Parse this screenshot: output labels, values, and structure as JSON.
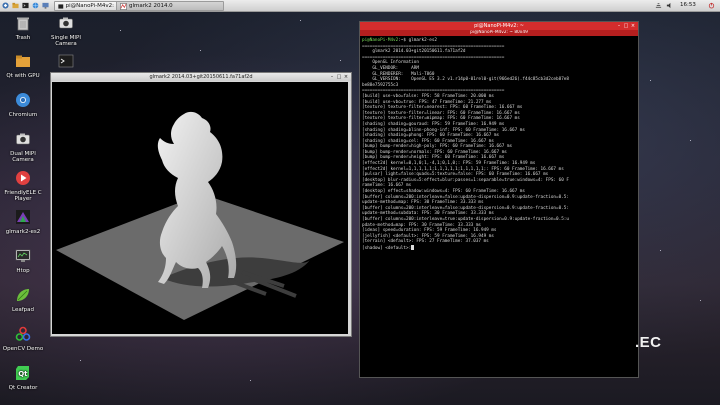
{
  "taskbar": {
    "tasks": [
      {
        "label": "pi@NanoPi-M4v2:"
      },
      {
        "label": "glmark2 2014.0"
      }
    ],
    "clock": "16:53"
  },
  "desktop": {
    "icons": [
      {
        "label": "Trash",
        "icon": "trash-icon"
      },
      {
        "label": "Single MIPI Camera",
        "icon": "camera-icon"
      },
      {
        "label": "Qt with GPU",
        "icon": "folder-icon"
      },
      {
        "label": "",
        "icon": "terminal-icon"
      },
      {
        "label": "Chromium",
        "icon": "chromium-icon"
      },
      {
        "label": "Dual MIPI Camera",
        "icon": "camera-icon"
      },
      {
        "label": "FriendlyELE C Player",
        "icon": "player-icon"
      },
      {
        "label": "glmark2-es2",
        "icon": "glmark-icon"
      },
      {
        "label": "Htop",
        "icon": "monitor-icon"
      },
      {
        "label": "Leafpad",
        "icon": "leafpad-icon"
      },
      {
        "label": "OpenCV Demo",
        "icon": "opencv-icon"
      },
      {
        "label": "Qt Creator",
        "icon": "qt-icon"
      }
    ]
  },
  "glmark_window": {
    "title": "glmark2 2014.03+git20150611.fa71af2d"
  },
  "terminal": {
    "title": "pi@NanoPi-M4v2: ~",
    "subtitle": "pi@NanoPi-M4v2: ~ 80x49",
    "prompt_user": "pi@NanoPi-M4v2",
    "prompt_cmd": ":~$ glmark2-es2",
    "lines": [
      "=======================================================",
      "    glmark2 2014.03+git20150611.fa71af2d",
      "=======================================================",
      "    OpenGL Information",
      "    GL_VENDOR:     ARM",
      "    GL_RENDERER:   Mali-T860",
      "    GL_VERSION:    OpenGL ES 3.2 v1.r14p0-01rel0-git(966ed26).f44c85cb3d2ceb87e8",
      "be88e7592755c3",
      "=======================================================",
      "[build] use-vbo=false: FPS: 58 FrameTime: 20.000 ms",
      "[build] use-vbo=true: FPS: 47 FrameTime: 21.277 ms",
      "[texture] texture-filter=nearest: FPS: 60 FrameTime: 16.667 ms",
      "[texture] texture-filter=linear: FPS: 60 FrameTime: 16.667 ms",
      "[texture] texture-filter=mipmap: FPS: 60 FrameTime: 16.667 ms",
      "[shading] shading=gouraud: FPS: 59 FrameTime: 16.949 ms",
      "[shading] shading=blinn-phong-inf: FPS: 60 FrameTime: 16.667 ms",
      "[shading] shading=phong: FPS: 60 FrameTime: 16.667 ms",
      "[shading] shading=cel: FPS: 60 FrameTime: 16.667 ms",
      "[bump] bump-render=high-poly: FPS: 60 FrameTime: 16.667 ms",
      "[bump] bump-render=normals: FPS: 60 FrameTime: 16.667 ms",
      "[bump] bump-render=height: FPS: 60 FrameTime: 16.667 ms",
      "[effect2d] kernel=0,1,0;1,-4,1;0,1,0;: FPS: 59 FrameTime: 16.949 ms",
      "[effect2d] kernel=1,1,1,1,1;1,1,1,1,1;1,1,1,1,1;: FPS: 60 FrameTime: 16.667 ms",
      "[pulsar] light=false:quads=5:texture=false: FPS: 60 FrameTime: 16.667 ms",
      "[desktop] blur-radius=5:effect=blur:passes=1:separable=true:windows=4: FPS: 60 F",
      "rameTime: 16.667 ms",
      "[desktop] effect=shadow:windows=4: FPS: 60 FrameTime: 16.667 ms",
      "[buffer] columns=200:interleave=false:update-dispersion=0.9:update-fraction=0.5:",
      "update-method=map: FPS: 30 FrameTime: 33.333 ms",
      "[buffer] columns=200:interleave=false:update-dispersion=0.9:update-fraction=0.5:",
      "update-method=subdata: FPS: 30 FrameTime: 33.333 ms",
      "[buffer] columns=200:interleave=true:update-dispersion=0.9:update-fraction=0.5:u",
      "pdate-method=map: FPS: 30 FrameTime: 33.333 ms",
      "[ideas] speed=duration: FPS: 59 FrameTime: 16.949 ms",
      "[jellyfish] <default>: FPS: 59 FrameTime: 16.949 ms",
      "[terrain] <default>: FPS: 27 FrameTime: 37.037 ms",
      "[shadow] <default>:"
    ]
  },
  "watermark": ".EC"
}
